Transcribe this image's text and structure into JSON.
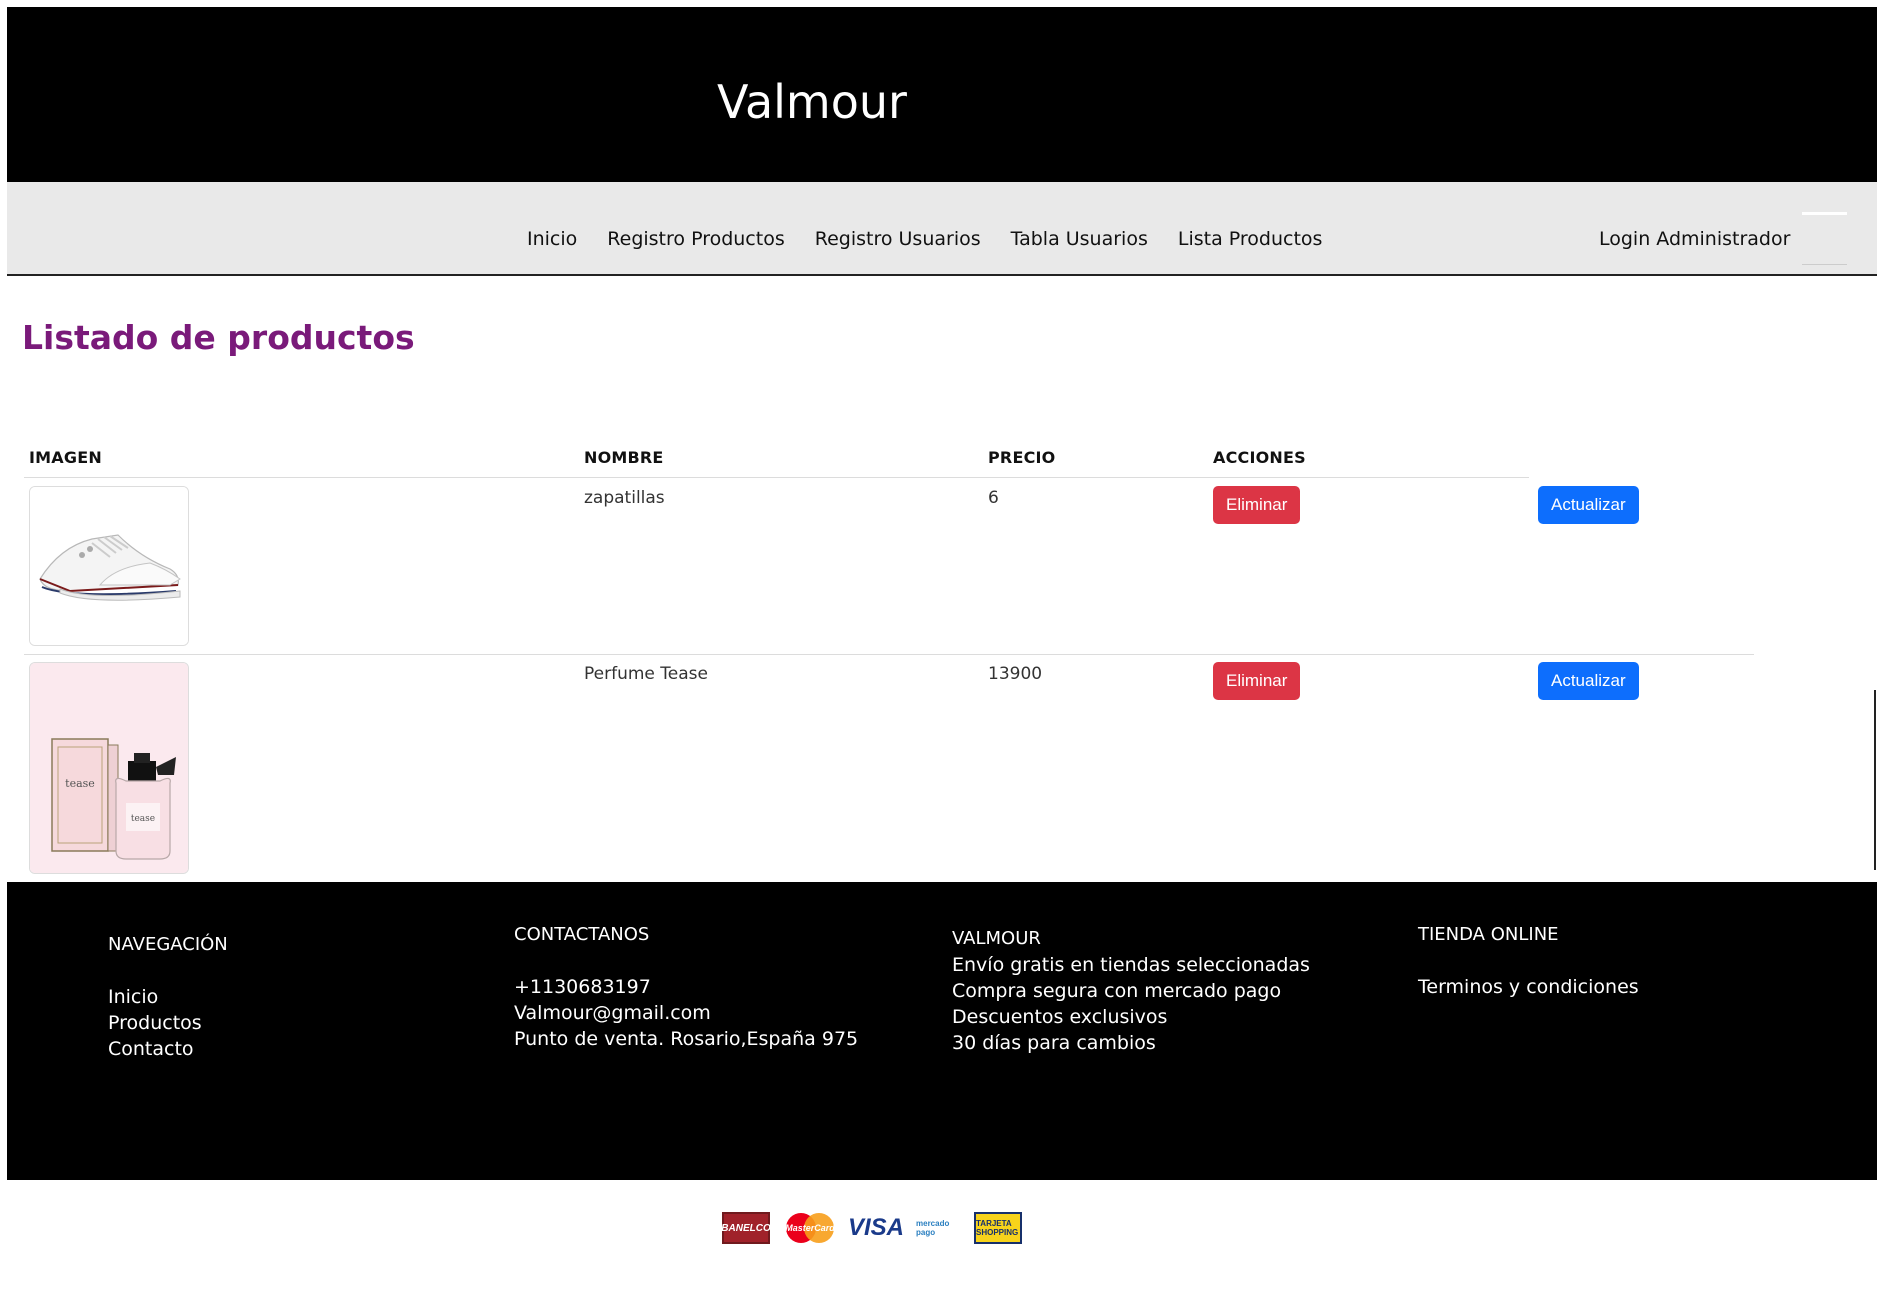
{
  "header": {
    "title": "Valmour"
  },
  "nav": {
    "links": [
      "Inicio",
      "Registro Productos",
      "Registro Usuarios",
      "Tabla Usuarios",
      "Lista Productos"
    ],
    "login": "Login Administrador"
  },
  "main": {
    "title": "Listado de productos",
    "columns": [
      "IMAGEN",
      "NOMBRE",
      "PRECIO",
      "ACCIONES"
    ],
    "rows": [
      {
        "name": "zapatillas",
        "price": "6",
        "image": "sneaker-image"
      },
      {
        "name": "Perfume Tease",
        "price": "13900",
        "image": "perfume-image"
      }
    ],
    "delete_label": "Eliminar",
    "update_label": "Actualizar"
  },
  "footer": {
    "nav_title": "NAVEGACIÓN",
    "nav_items": [
      "Inicio",
      "Productos",
      "Contacto"
    ],
    "contact_title": "CONTACTANOS",
    "contact_lines": [
      "+1130683197",
      "Valmour@gmail.com",
      "Punto de venta. Rosario,España 975"
    ],
    "brand_title": "VALMOUR",
    "brand_lines": [
      "Envío gratis en tiendas seleccionadas",
      "Compra segura con mercado pago",
      "Descuentos exclusivos",
      "30 días para cambios"
    ],
    "shop_title": "TIENDA ONLINE",
    "shop_lines": [
      "Terminos y condiciones"
    ]
  },
  "payments": [
    "BANELCO",
    "MasterCard",
    "VISA",
    "mercado pago",
    "TARJETA SHOPPING"
  ],
  "colors": {
    "title_purple": "#7a1a7a",
    "danger": "#dc3545",
    "primary": "#0d6efd"
  }
}
